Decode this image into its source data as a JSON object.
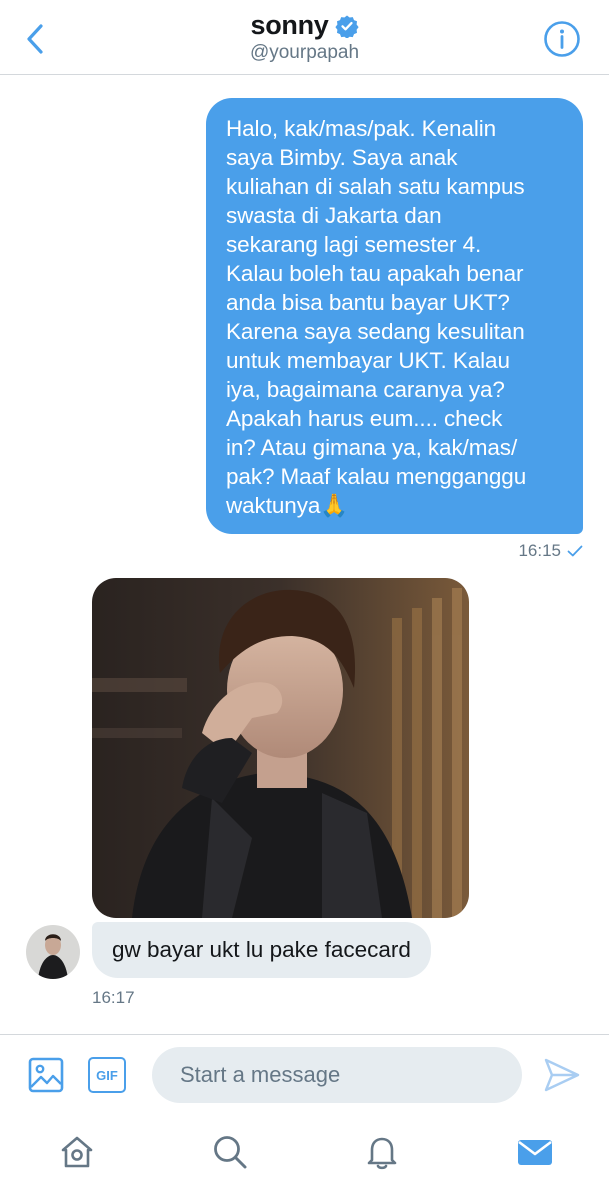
{
  "header": {
    "title": "sonny",
    "handle": "@yourpapah",
    "back_icon": "chevron-left-icon",
    "info_icon": "info-icon",
    "verified_icon": "verified-badge-icon"
  },
  "conversation": {
    "outgoing_message": {
      "lines": [
        "Halo, kak/mas/pak. Kenalin",
        "saya Bimby. Saya anak",
        "kuliahan di salah satu kampus",
        "swasta di Jakarta dan",
        "sekarang lagi semester 4.",
        "Kalau boleh tau apakah benar",
        "anda bisa bantu bayar UKT?",
        "Karena saya sedang kesulitan",
        "untuk membayar UKT. Kalau",
        "iya, bagaimana caranya ya?",
        "Apakah harus eum.... check",
        "in? Atau gimana ya, kak/mas/",
        "pak? Maaf kalau mengganggu",
        "waktunya🙏"
      ],
      "time": "16:15",
      "status_icon": "checkmark-icon"
    },
    "incoming_message": {
      "text": "gw bayar ukt lu pake facecard",
      "time": "16:17"
    }
  },
  "composer": {
    "placeholder": "Start a message",
    "media_icon": "image-icon",
    "gif_label": "GIF",
    "send_icon": "send-icon"
  },
  "tabbar": {
    "items": [
      "home-icon",
      "search-icon",
      "notifications-icon",
      "messages-icon"
    ]
  },
  "colors": {
    "accent": "#4a9fea",
    "incoming_bubble": "#e6ecf0",
    "muted_text": "#657786"
  }
}
